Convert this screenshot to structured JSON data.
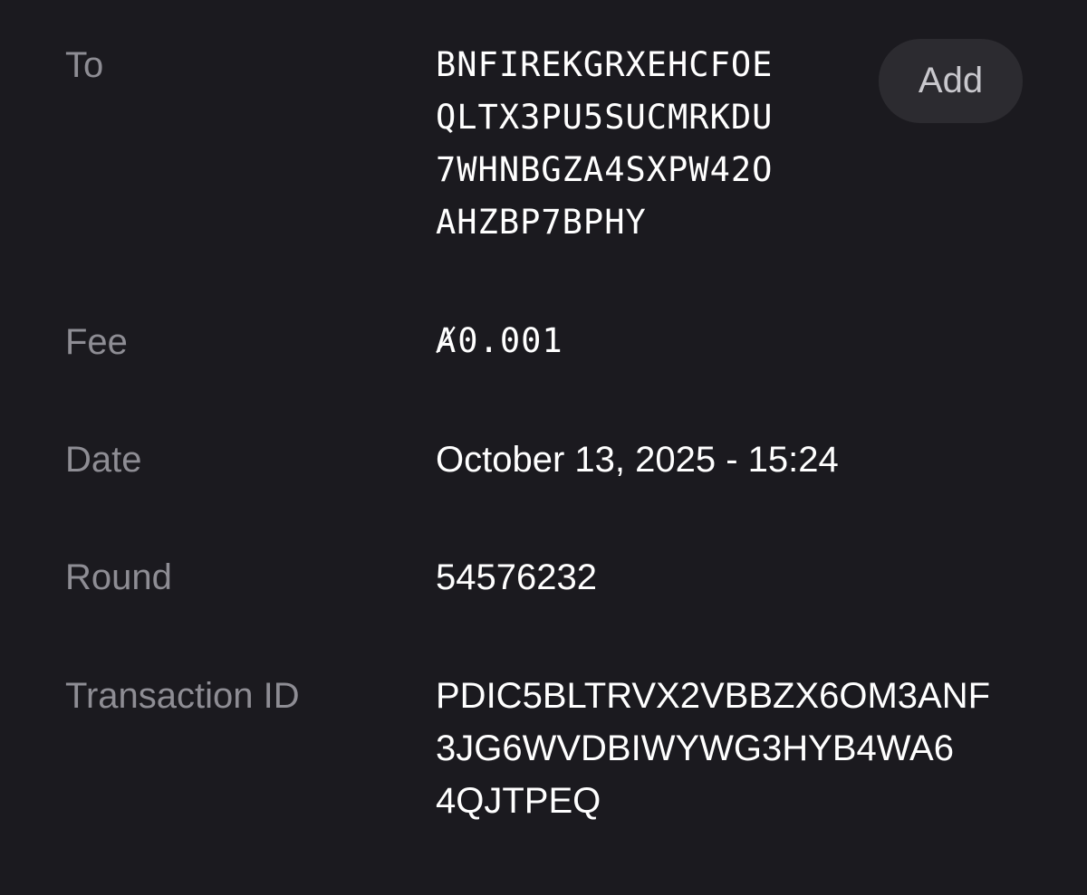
{
  "to": {
    "label": "To",
    "address_lines": [
      "BNFIREKGRXEHCFOE",
      "QLTX3PU5SUCMRKDU",
      "7WHNBGZA4SXPW42O",
      "AHZBP7BPHY"
    ],
    "add_button_label": "Add"
  },
  "fee": {
    "label": "Fee",
    "currency_symbol": "Ⱥ",
    "amount": "0.001"
  },
  "date": {
    "label": "Date",
    "value": "October 13, 2025 - 15:24"
  },
  "round": {
    "label": "Round",
    "value": "54576232"
  },
  "transaction_id": {
    "label": "Transaction ID",
    "lines": [
      "PDIC5BLTRVX2VBBZX6OM3ANF",
      "3JG6WVDBIWYWG3HYB4WA6",
      "4QJTPEQ"
    ]
  }
}
